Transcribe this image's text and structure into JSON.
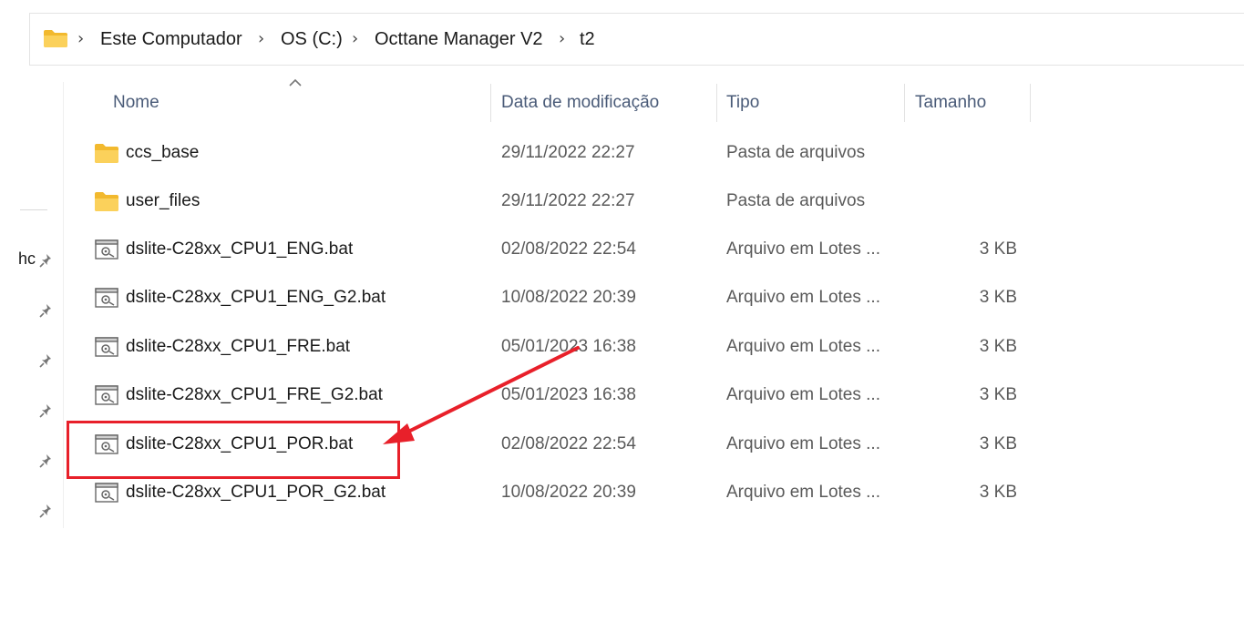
{
  "breadcrumb": [
    {
      "label": "Este Computador"
    },
    {
      "label": "OS (C:)"
    },
    {
      "label": "Octtane Manager V2"
    },
    {
      "label": "t2"
    }
  ],
  "nav": {
    "partial_label": "hc"
  },
  "columns": {
    "name": "Nome",
    "date": "Data de modificação",
    "type": "Tipo",
    "size": "Tamanho"
  },
  "files": [
    {
      "name": "ccs_base",
      "date": "29/11/2022 22:27",
      "type": "Pasta de arquivos",
      "size": "",
      "icon": "folder-icon"
    },
    {
      "name": "user_files",
      "date": "29/11/2022 22:27",
      "type": "Pasta de arquivos",
      "size": "",
      "icon": "folder-icon"
    },
    {
      "name": "dslite-C28xx_CPU1_ENG.bat",
      "date": "02/08/2022 22:54",
      "type": "Arquivo em Lotes ...",
      "size": "3 KB",
      "icon": "batch-file-icon"
    },
    {
      "name": "dslite-C28xx_CPU1_ENG_G2.bat",
      "date": "10/08/2022 20:39",
      "type": "Arquivo em Lotes ...",
      "size": "3 KB",
      "icon": "batch-file-icon"
    },
    {
      "name": "dslite-C28xx_CPU1_FRE.bat",
      "date": "05/01/2023 16:38",
      "type": "Arquivo em Lotes ...",
      "size": "3 KB",
      "icon": "batch-file-icon"
    },
    {
      "name": "dslite-C28xx_CPU1_FRE_G2.bat",
      "date": "05/01/2023 16:38",
      "type": "Arquivo em Lotes ...",
      "size": "3 KB",
      "icon": "batch-file-icon"
    },
    {
      "name": "dslite-C28xx_CPU1_POR.bat",
      "date": "02/08/2022 22:54",
      "type": "Arquivo em Lotes ...",
      "size": "3 KB",
      "icon": "batch-file-icon"
    },
    {
      "name": "dslite-C28xx_CPU1_POR_G2.bat",
      "date": "10/08/2022 20:39",
      "type": "Arquivo em Lotes ...",
      "size": "3 KB",
      "icon": "batch-file-icon"
    }
  ],
  "colors": {
    "folder": "#F7C948",
    "annotation": "#E8202A",
    "header_text": "#4A5B78"
  }
}
